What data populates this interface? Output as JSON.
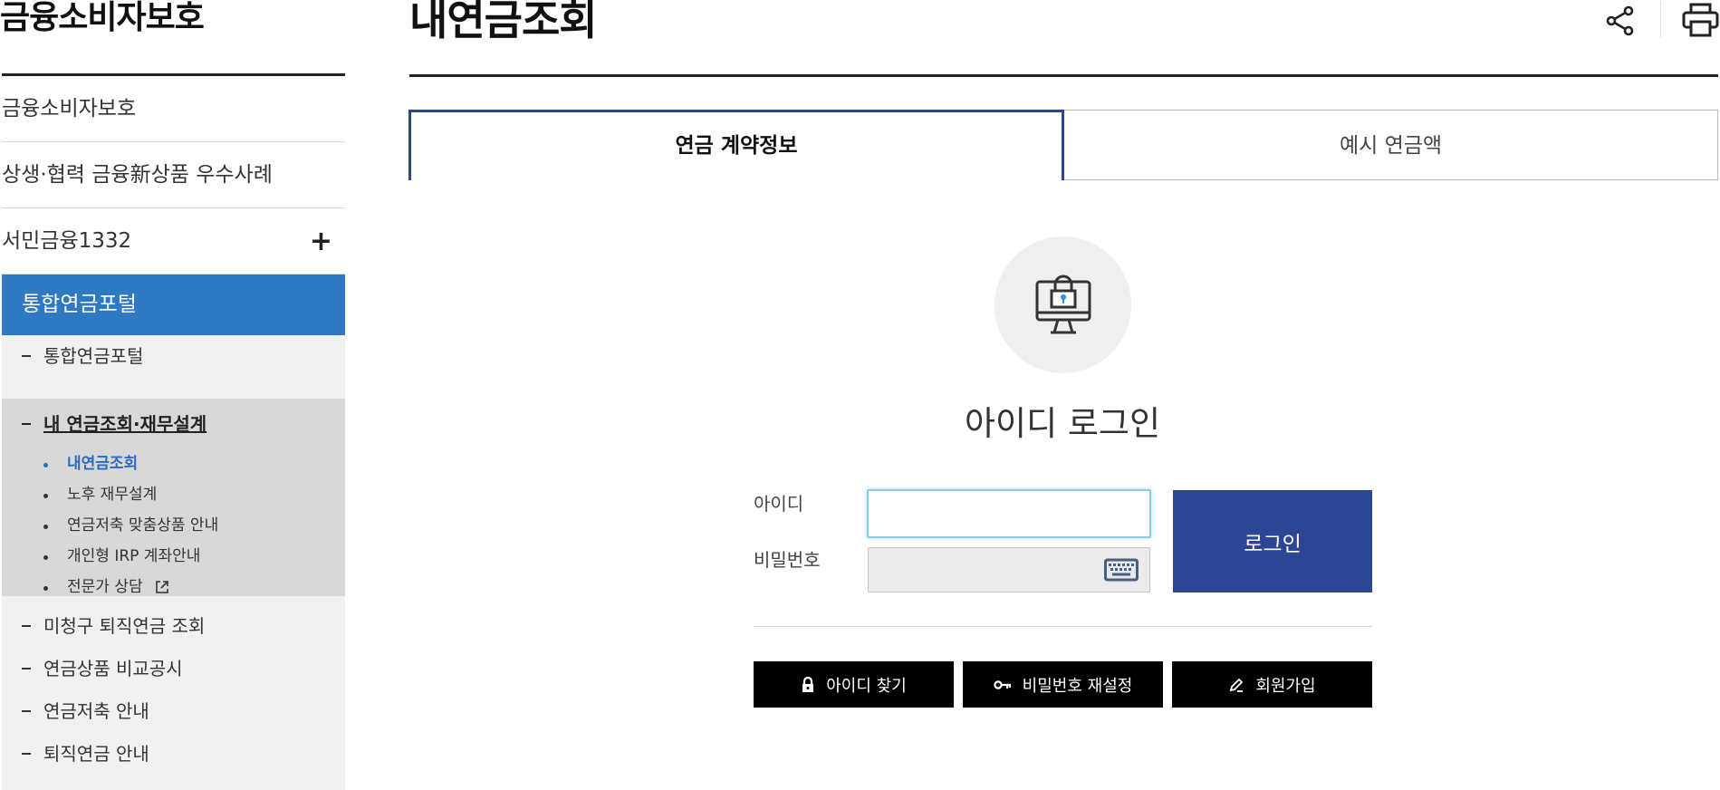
{
  "sidebar": {
    "title": "금융소비자보호",
    "items": [
      {
        "label": "금융소비자보호"
      },
      {
        "label": "상생·협력 금융新상품 우수사례"
      },
      {
        "label": "서민금융1332",
        "expand": "+"
      }
    ],
    "active_section": "통합연금포털",
    "sub_items": {
      "top": {
        "label": "통합연금포털"
      },
      "current_group": {
        "label": "내 연금조회·재무설계",
        "leaves": [
          {
            "label": "내연금조회"
          },
          {
            "label": "노후 재무설계"
          },
          {
            "label": "연금저축 맞춤상품 안내"
          },
          {
            "label": "개인형 IRP 계좌안내"
          },
          {
            "label": "전문가 상담"
          }
        ]
      },
      "after": [
        {
          "label": "미청구 퇴직연금 조회"
        },
        {
          "label": "연금상품 비교공시"
        },
        {
          "label": "연금저축 안내"
        },
        {
          "label": "퇴직연금 안내"
        }
      ]
    }
  },
  "header": {
    "title": "내연금조회",
    "share_icon": "share-icon",
    "print_icon": "print-icon"
  },
  "tabs": [
    {
      "label": "연금 계약정보"
    },
    {
      "label": "예시 연금액"
    }
  ],
  "login": {
    "icon": "secure-computer-icon",
    "title": "아이디 로그인",
    "id_label": "아이디",
    "id_value": "",
    "pw_label": "비밀번호",
    "pw_value": "",
    "keyboard_icon": "keyboard-icon",
    "submit_label": "로그인",
    "actions": [
      {
        "label": "아이디 찾기",
        "icon": "lock-icon"
      },
      {
        "label": "비밀번호 재설정",
        "icon": "key-icon"
      },
      {
        "label": "회원가입",
        "icon": "pencil-icon"
      }
    ]
  },
  "colors": {
    "accent_blue": "#2f79c2",
    "navy": "#2c4595",
    "current_link": "#2a6cc0"
  }
}
